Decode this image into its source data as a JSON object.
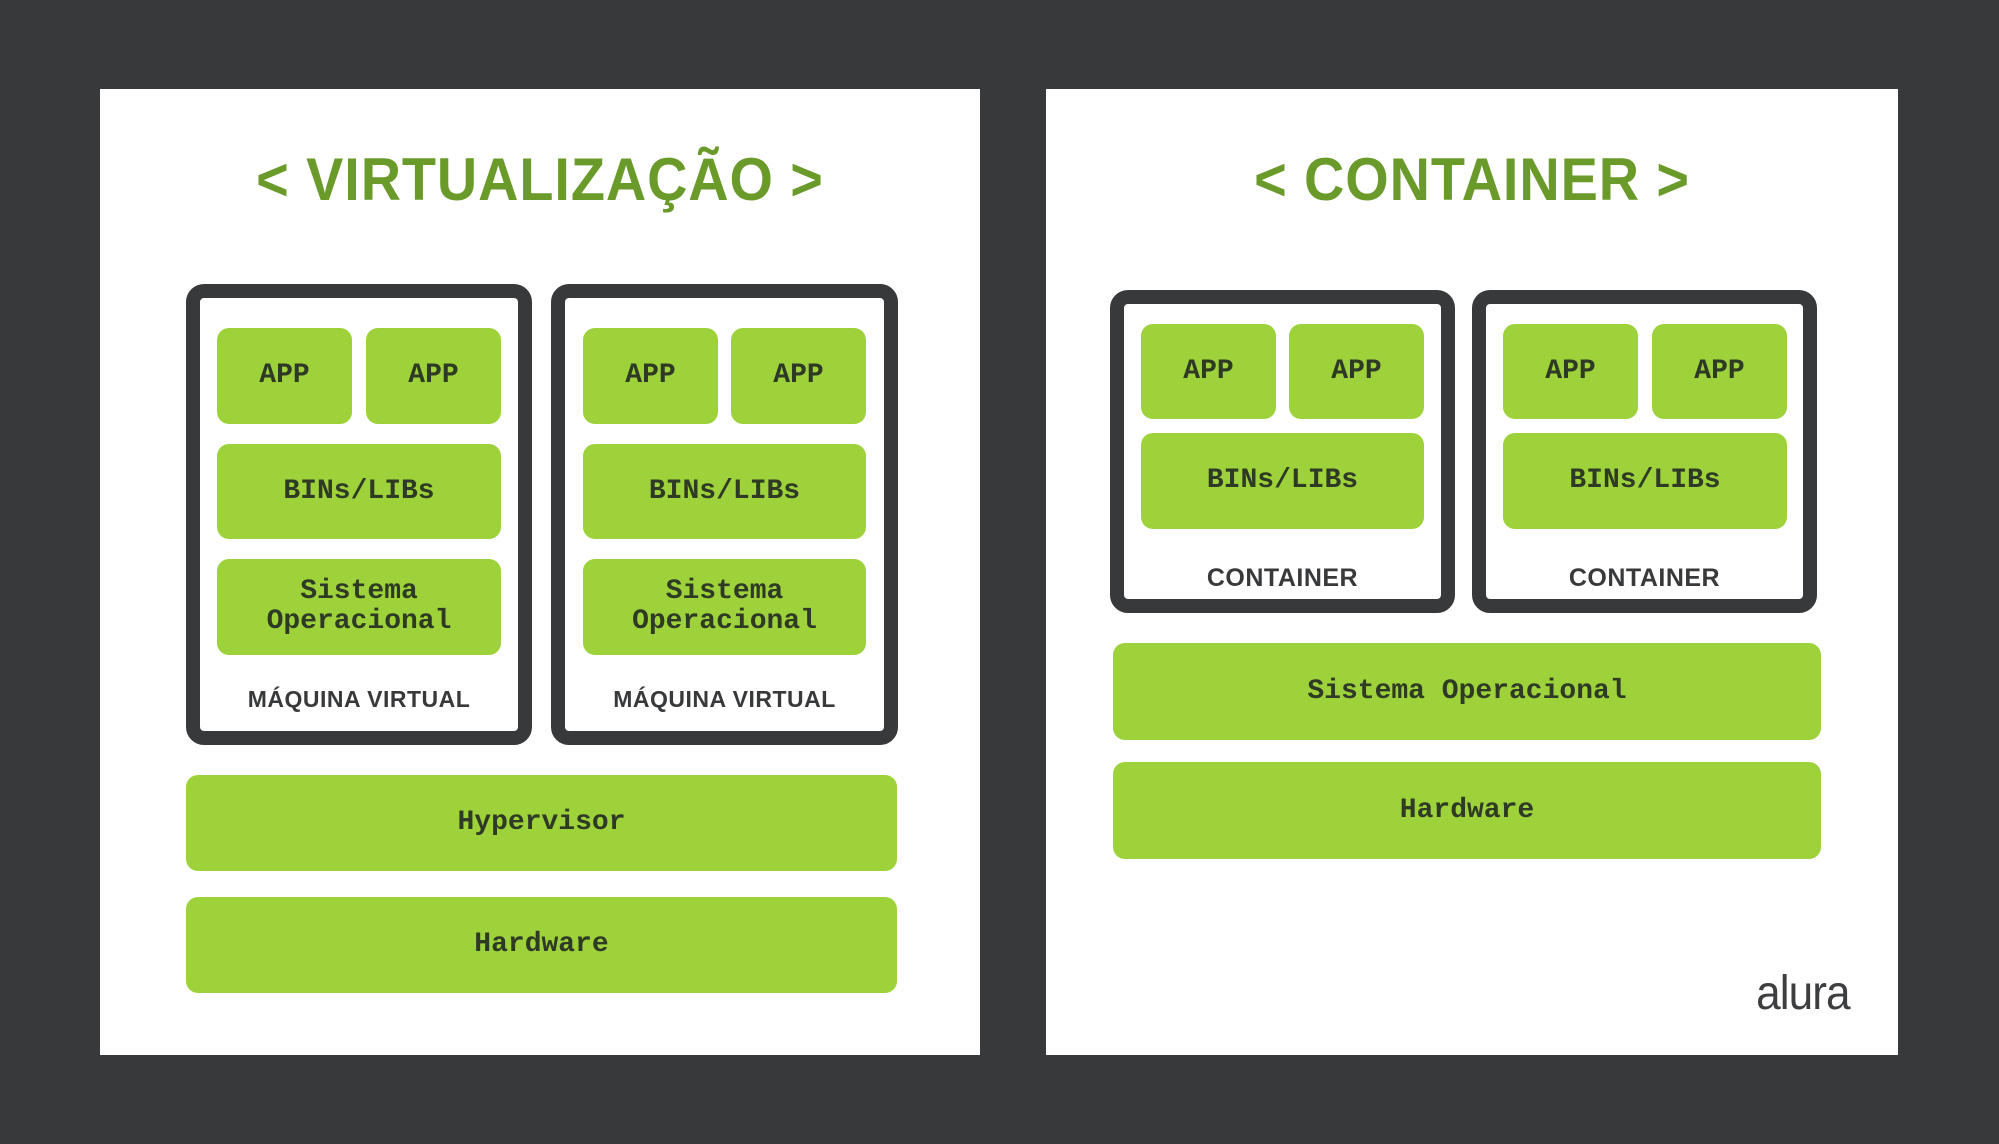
{
  "colors": {
    "background": "#38393b",
    "panel": "#ffffff",
    "title_green": "#6a9a2a",
    "block_green": "#9dd23b",
    "frame_dark": "#38393b",
    "block_text": "#2f3a25"
  },
  "virtualization": {
    "title": "< VIRTUALIZAÇÃO >",
    "machines": [
      {
        "label": "MÁQUINA VIRTUAL",
        "apps": [
          "APP",
          "APP"
        ],
        "bins_libs": "BINs/LIBs",
        "os_line1": "Sistema",
        "os_line2": "Operacional"
      },
      {
        "label": "MÁQUINA VIRTUAL",
        "apps": [
          "APP",
          "APP"
        ],
        "bins_libs": "BINs/LIBs",
        "os_line1": "Sistema",
        "os_line2": "Operacional"
      }
    ],
    "hypervisor": "Hypervisor",
    "hardware": "Hardware"
  },
  "container": {
    "title": "< CONTAINER >",
    "containers": [
      {
        "label": "CONTAINER",
        "apps": [
          "APP",
          "APP"
        ],
        "bins_libs": "BINs/LIBs"
      },
      {
        "label": "CONTAINER",
        "apps": [
          "APP",
          "APP"
        ],
        "bins_libs": "BINs/LIBs"
      }
    ],
    "operating_system": "Sistema Operacional",
    "hardware": "Hardware"
  },
  "brand": {
    "logo_text": "alura"
  }
}
